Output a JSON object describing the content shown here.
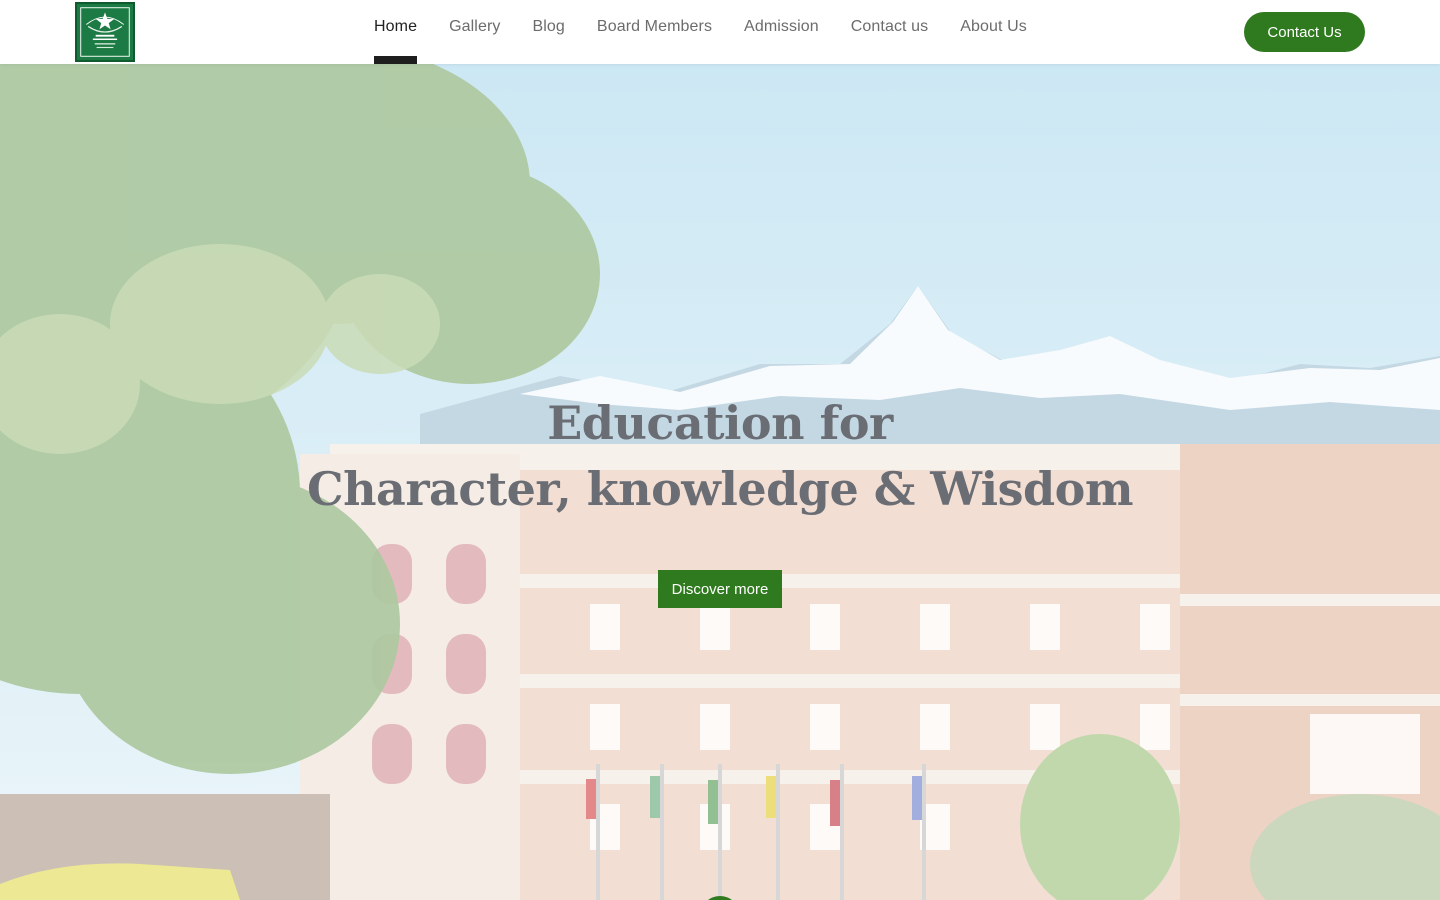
{
  "brand": {
    "logo_icon": "school-emblem-icon",
    "logo_color": "#1c7a44"
  },
  "nav": {
    "items": [
      {
        "label": "Home",
        "active": true
      },
      {
        "label": "Gallery",
        "active": false
      },
      {
        "label": "Blog",
        "active": false
      },
      {
        "label": "Board Members",
        "active": false
      },
      {
        "label": "Admission",
        "active": false
      },
      {
        "label": "Contact us",
        "active": false
      },
      {
        "label": "About Us",
        "active": false
      }
    ]
  },
  "header": {
    "cta_label": "Contact Us"
  },
  "hero": {
    "title_line1": "Education for",
    "title_line2": "Character, knowledge & Wisdom",
    "button_label": "Discover more"
  },
  "colors": {
    "accent": "#2f7a1e",
    "title": "#6a6e74",
    "nav_text": "#6c6c6c",
    "nav_active": "#222222"
  }
}
